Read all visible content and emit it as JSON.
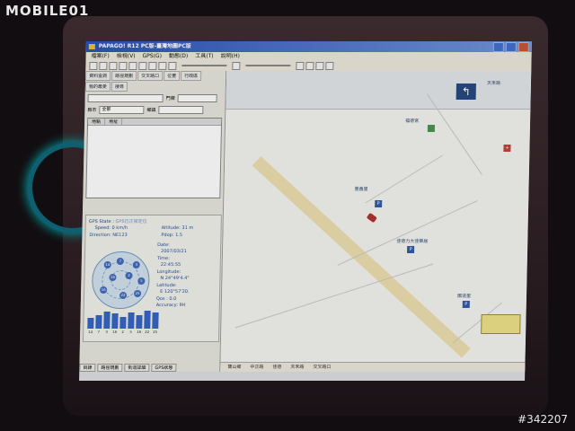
{
  "site": {
    "logo": "MOBILE01",
    "watermark": "#342207"
  },
  "window": {
    "title": "PAPAGO! R12 PC版-臺灣地圖PC版"
  },
  "menu": [
    "檔案(F)",
    "檢視(V)",
    "GPS(G)",
    "動態(D)",
    "工具(T)",
    "說明(H)"
  ],
  "left_tabs": [
    "資料查詢",
    "路徑規劃",
    "交叉路口",
    "位置",
    "行政區",
    "我的最愛",
    "搜尋"
  ],
  "form": {
    "city_label": "縣市",
    "city_value": "全部",
    "town_label": "鄉鎮",
    "door_label": "門牌"
  },
  "list_columns": [
    "地點",
    "地址"
  ],
  "gps": {
    "state_label": "GPS State :",
    "state_value": "GPS已正常定位",
    "speed": "Speed: 0 km/h",
    "altitude": "Altitude: 31 m",
    "direction": "Direction: NE123",
    "pdop": "Pdop: 1.5",
    "date_label": "Date:",
    "date": "2007/03/21",
    "time_label": "Time:",
    "time": "22:45:55",
    "longitude_label": "Longitude:",
    "longitude": "N 24°49'4.4\"",
    "latitude_label": "Latitude:",
    "latitude": "E 120°57'20.",
    "qos": "Qos : 0.0",
    "accuracy": "Accuracy: 9H",
    "satellites": [
      "14",
      "7",
      "3",
      "16",
      "2",
      "5",
      "16",
      "22",
      "25"
    ],
    "signal_levels": [
      0.55,
      0.7,
      0.85,
      0.75,
      0.6,
      0.8,
      0.7,
      0.9,
      0.8
    ]
  },
  "bottom_tabs": [
    "目錄",
    "路徑規劃",
    "街道詳細",
    "GPS狀態"
  ],
  "map": {
    "top_right_label": "天禾路",
    "labels": [
      "福德宮",
      "佳德力大佳樂居",
      "國道里",
      "豐鑫里"
    ],
    "turn_symbol": "↰"
  },
  "statusbar": [
    "寶山鄉",
    "中正路",
    "佳德",
    "天禾路",
    "交叉路口"
  ]
}
